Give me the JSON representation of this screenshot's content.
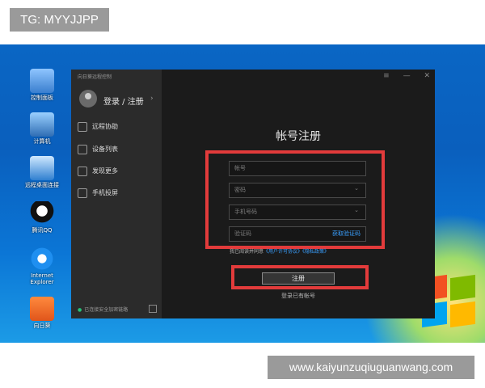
{
  "watermarks": {
    "top": "TG: MYYJJPP",
    "bottom": "www.kaiyunzuqiuguanwang.com"
  },
  "desktop": {
    "icons": [
      {
        "label": "控制面板",
        "icon": "control-panel-icon"
      },
      {
        "label": "计算机",
        "icon": "computer-icon"
      },
      {
        "label": "远程桌面连接",
        "icon": "remote-desktop-icon"
      },
      {
        "label": "腾讯QQ",
        "icon": "qq-icon"
      },
      {
        "label": "Internet Explorer",
        "icon": "ie-icon"
      },
      {
        "label": "向日葵",
        "icon": "sunlogin-icon"
      }
    ]
  },
  "app": {
    "window_title": "向日葵远程控制",
    "login_label": "登录 / 注册",
    "nav": [
      {
        "label": "远程协助",
        "icon": "remote-assist-icon"
      },
      {
        "label": "设备列表",
        "icon": "device-list-icon"
      },
      {
        "label": "发现更多",
        "icon": "discover-icon"
      },
      {
        "label": "手机投屏",
        "icon": "phone-cast-icon"
      }
    ],
    "footer_status": "已连接安全加密链路",
    "controls": {
      "menu": "≡",
      "minimize": "—",
      "close": "✕"
    }
  },
  "form": {
    "title": "帐号注册",
    "account_placeholder": "帐号",
    "password_placeholder": "密码",
    "phone_placeholder": "手机号码",
    "code_placeholder": "验证码",
    "get_code": "获取验证码",
    "agree_prefix": "我已阅读并同意",
    "agree_link1": "《用户许可协议》",
    "agree_link2": "《隐私政策》",
    "register_button": "注册",
    "login_link": "登录已有帐号"
  },
  "colors": {
    "accent": "#3aa0ff",
    "highlight": "#e23b3b",
    "desktop": "#0a66c4"
  }
}
